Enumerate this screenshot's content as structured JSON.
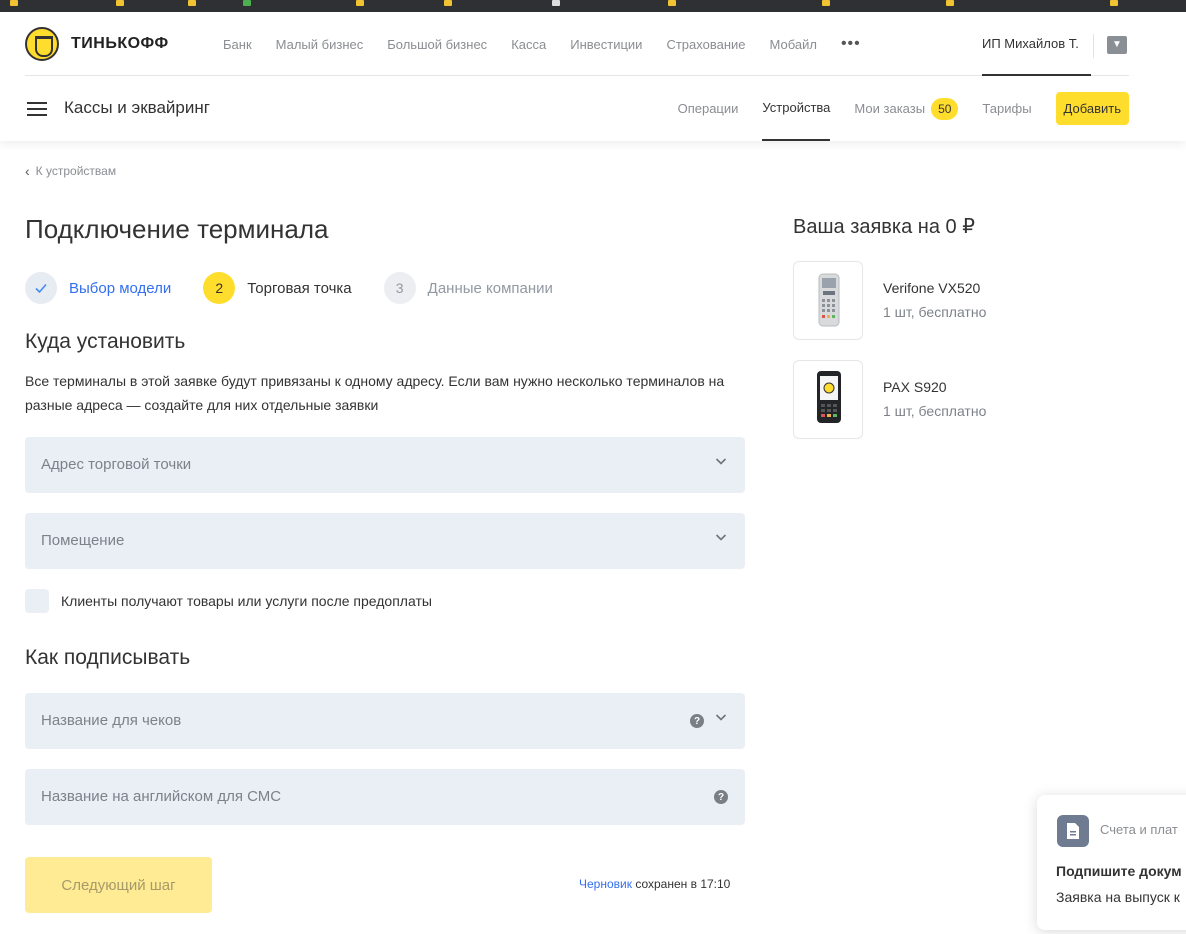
{
  "top_nav": {
    "brand": "ТИНЬКОФФ",
    "items": [
      {
        "label": "Банк"
      },
      {
        "label": "Малый бизнес"
      },
      {
        "label": "Большой бизнес"
      },
      {
        "label": "Касса"
      },
      {
        "label": "Инвестиции"
      },
      {
        "label": "Страхование"
      },
      {
        "label": "Мобайл"
      }
    ],
    "more": "•••",
    "user": "ИП Михайлов Т."
  },
  "sub_nav": {
    "title": "Кассы и эквайринг",
    "tabs": [
      {
        "label": "Операции"
      },
      {
        "label": "Устройства",
        "active": true
      },
      {
        "label": "Мои заказы",
        "badge": "50"
      },
      {
        "label": "Тарифы"
      }
    ],
    "add_button": "Добавить"
  },
  "back_link": "К устройствам",
  "page_title": "Подключение терминала",
  "steps": [
    {
      "number": "✓",
      "label": "Выбор модели",
      "state": "done"
    },
    {
      "number": "2",
      "label": "Торговая точка",
      "state": "current"
    },
    {
      "number": "3",
      "label": "Данные компании",
      "state": "pending"
    }
  ],
  "install_section": {
    "title": "Куда установить",
    "description": "Все терминалы в этой заявке будут привязаны к одному адресу. Если вам нужно несколько терминалов на разные адреса — создайте для них отдельные заявки",
    "address_field": "Адрес торговой точки",
    "room_field": "Помещение",
    "prepay_checkbox": "Клиенты получают товары или услуги после предоплаты"
  },
  "sign_section": {
    "title": "Как подписывать",
    "receipt_name_field": "Название для чеков",
    "sms_name_field": "Название на английском для СМС"
  },
  "next_button": "Следующий шаг",
  "draft": {
    "link": "Черновик",
    "text": "сохранен в 17:10"
  },
  "order": {
    "title": "Ваша заявка на 0 ₽",
    "items": [
      {
        "name": "Verifone VX520",
        "qty": "1 шт, бесплатно"
      },
      {
        "name": "PAX S920",
        "qty": "1 шт, бесплатно"
      }
    ]
  },
  "notification": {
    "app": "Счета и плат",
    "title": "Подпишите докум",
    "text": "Заявка на выпуск к"
  },
  "colors": {
    "accent_yellow": "#ffdd2d",
    "link_blue": "#336fee",
    "field_bg": "#eaeef5"
  }
}
